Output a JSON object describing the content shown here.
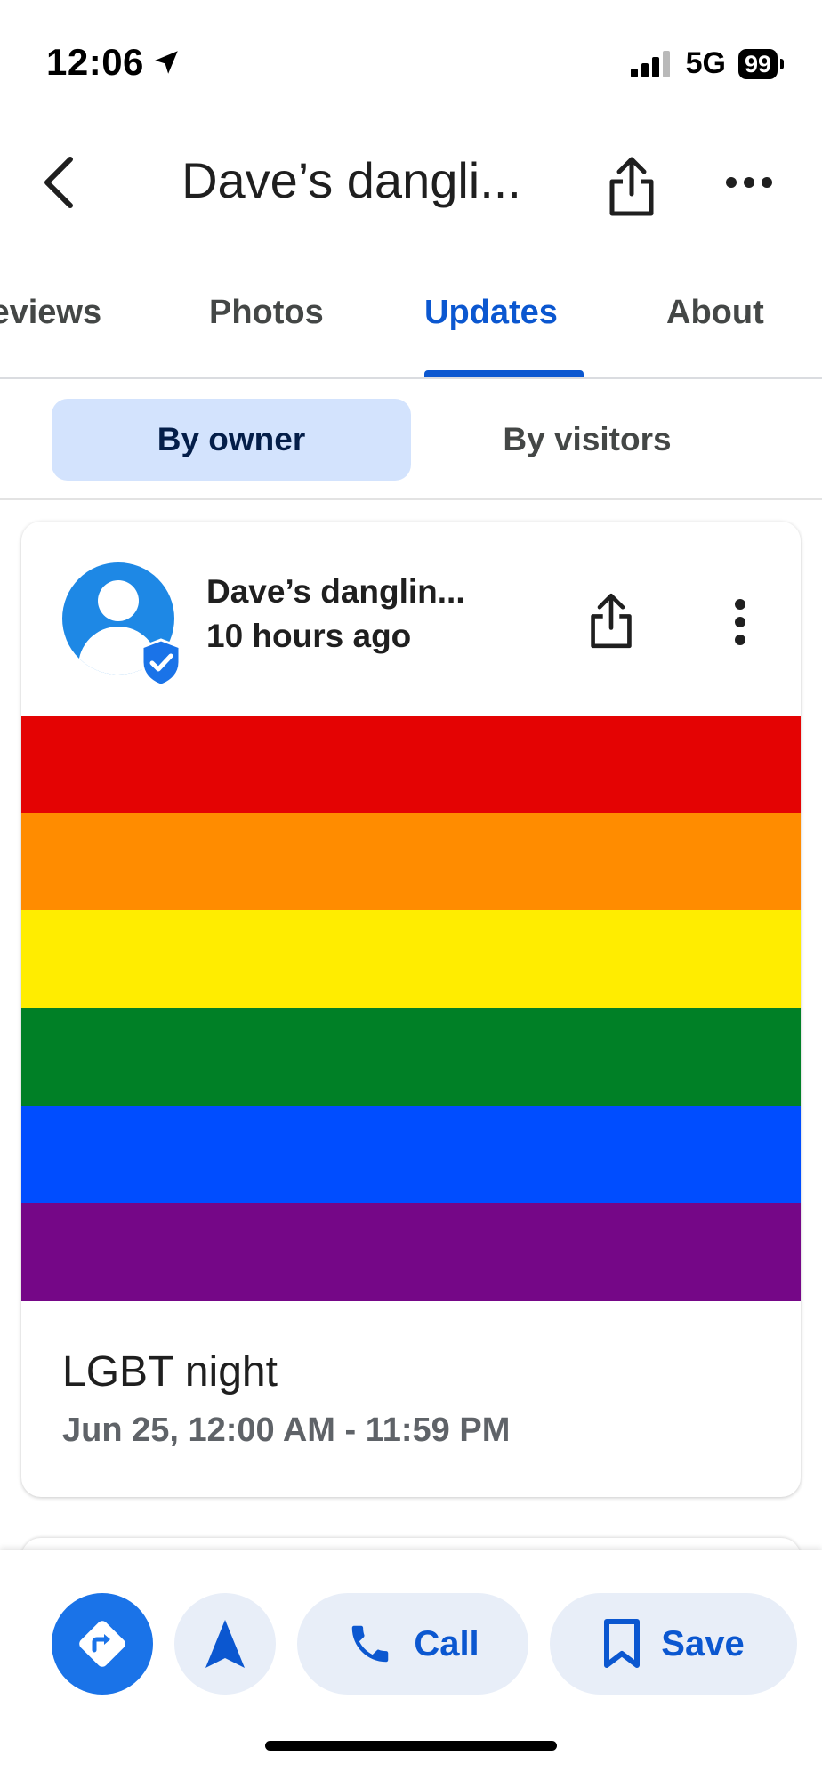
{
  "status_bar": {
    "time": "12:06",
    "network": "5G",
    "battery": "99"
  },
  "header": {
    "title": "Dave’s dangli..."
  },
  "tabs": [
    {
      "label": "Reviews"
    },
    {
      "label": "Photos"
    },
    {
      "label": "Updates"
    },
    {
      "label": "About"
    }
  ],
  "active_tab": "Updates",
  "filter": {
    "owner_label": "By owner",
    "visitors_label": "By visitors"
  },
  "post": {
    "author": "Dave’s danglin...",
    "time_ago": "10 hours ago",
    "flag_colors": [
      "#e40303",
      "#ff8c00",
      "#ffed00",
      "#008026",
      "#004dff",
      "#750787"
    ],
    "event_title": "LGBT night",
    "event_date": "Jun 25, 12:00 AM - 11:59 PM"
  },
  "actions": {
    "call_label": "Call",
    "save_label": "Save"
  },
  "colors": {
    "accent": "#0b57d0",
    "selected_bg": "#d3e3fd",
    "directions_bg": "#1a73e8"
  },
  "icons": [
    "location-arrow-icon",
    "signal-icon",
    "back-arrow-icon",
    "share-icon",
    "more-horizontal-icon",
    "more-vertical-icon",
    "verified-badge-icon",
    "directions-icon",
    "navigate-icon",
    "phone-icon",
    "bookmark-icon"
  ]
}
